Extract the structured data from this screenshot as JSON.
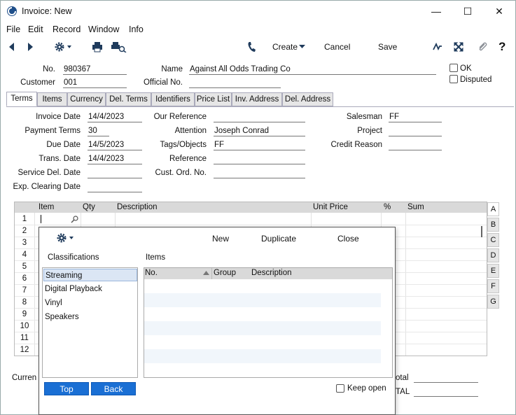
{
  "window": {
    "title": "Invoice: New",
    "minimize": "—",
    "maximize": "☐",
    "close": "✕"
  },
  "menu": [
    "File",
    "Edit",
    "Record",
    "Window",
    "Info"
  ],
  "toolbar": {
    "create": "Create",
    "cancel": "Cancel",
    "save": "Save"
  },
  "header": {
    "no_label": "No.",
    "no_value": "980367",
    "customer_label": "Customer",
    "customer_value": "001",
    "name_label": "Name",
    "name_value": "Against All Odds Trading Co",
    "official_label": "Official No.",
    "official_value": "",
    "ok_label": "OK",
    "disputed_label": "Disputed"
  },
  "tabs": [
    "Terms",
    "Items",
    "Currency",
    "Del. Terms",
    "Identifiers",
    "Price List",
    "Inv. Address",
    "Del. Address"
  ],
  "terms": {
    "invoice_date_label": "Invoice Date",
    "invoice_date": "14/4/2023",
    "payment_terms_label": "Payment Terms",
    "payment_terms": "30",
    "due_date_label": "Due Date",
    "due_date": "14/5/2023",
    "trans_date_label": "Trans. Date",
    "trans_date": "14/4/2023",
    "service_del_label": "Service Del. Date",
    "service_del": "",
    "exp_clearing_label": "Exp. Clearing Date",
    "exp_clearing": "",
    "our_ref_label": "Our Reference",
    "our_ref": "",
    "attention_label": "Attention",
    "attention": "Joseph Conrad",
    "tags_label": "Tags/Objects",
    "tags": "FF",
    "reference_label": "Reference",
    "reference": "",
    "cust_ord_label": "Cust. Ord. No.",
    "cust_ord": "",
    "salesman_label": "Salesman",
    "salesman": "FF",
    "project_label": "Project",
    "project": "",
    "credit_reason_label": "Credit Reason",
    "credit_reason": ""
  },
  "grid": {
    "columns": [
      "Item",
      "Qty",
      "Description",
      "Unit Price",
      "%",
      "Sum"
    ],
    "rows": [
      "1",
      "2",
      "3",
      "4",
      "5",
      "6",
      "7",
      "8",
      "9",
      "10",
      "11",
      "12"
    ],
    "side_tabs": [
      "A",
      "B",
      "C",
      "D",
      "E",
      "F",
      "G"
    ]
  },
  "footer": {
    "currency_label": "Curren",
    "total_label": "otal",
    "grand_total_label": "TAL"
  },
  "popup": {
    "new": "New",
    "duplicate": "Duplicate",
    "close": "Close",
    "classifications_label": "Classifications",
    "items_label": "Items",
    "classifications": [
      "Streaming",
      "Digital Playback",
      "Vinyl",
      "Speakers"
    ],
    "item_columns": [
      "No.",
      "Group",
      "Description"
    ],
    "top": "Top",
    "back": "Back",
    "keep_open": "Keep open"
  }
}
